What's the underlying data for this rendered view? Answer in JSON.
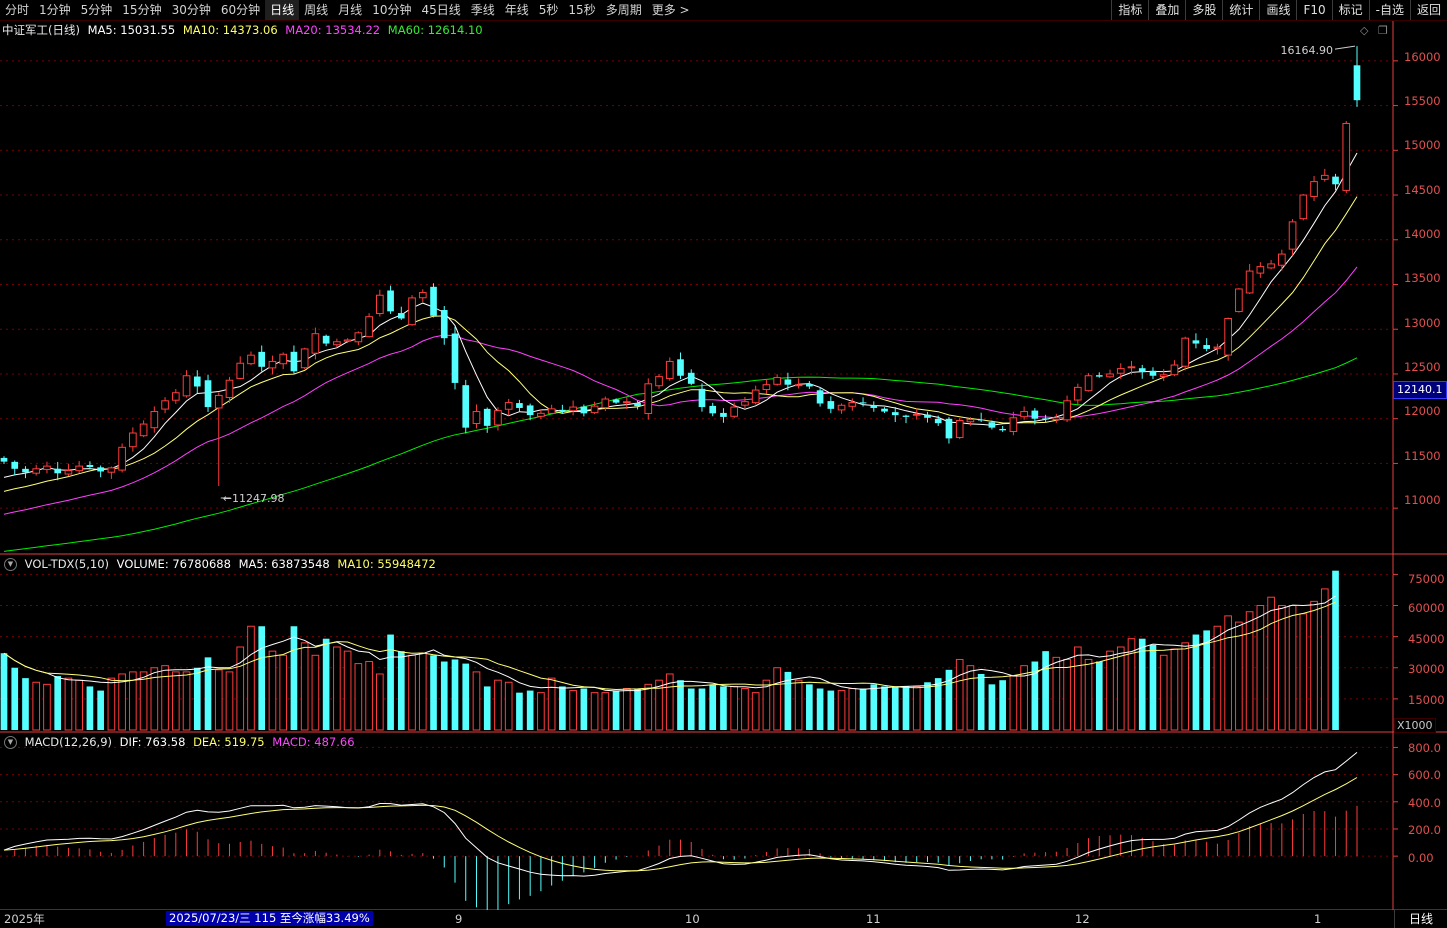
{
  "toolbar": {
    "periods": [
      "分时",
      "1分钟",
      "5分钟",
      "15分钟",
      "30分钟",
      "60分钟",
      "日线",
      "周线",
      "月线",
      "10分钟",
      "45日线",
      "季线",
      "年线",
      "5秒",
      "15秒",
      "多周期",
      "更多 >"
    ],
    "active_period": "日线",
    "tools": [
      "指标",
      "叠加",
      "多股",
      "统计",
      "画线",
      "F10",
      "标记",
      "-自选",
      "返回"
    ]
  },
  "price_header": {
    "name": "中证军工(日线)",
    "ma5": "MA5: 15031.55",
    "ma10": "MA10: 14373.06",
    "ma20": "MA20: 13534.22",
    "ma60": "MA60: 12614.10"
  },
  "volume_header": {
    "name": "VOL-TDX(5,10)",
    "volume": "VOLUME: 76780688",
    "ma5": "MA5: 63873548",
    "ma10": "MA10: 55948472"
  },
  "macd_header": {
    "name": "MACD(12,26,9)",
    "dif": "DIF: 763.58",
    "dea": "DEA: 519.75",
    "macd": "MACD: 487.66"
  },
  "annotations": {
    "high_label": "16164.90",
    "low_label": "11247.98",
    "current_price_tag": "12140.1",
    "volume_unit": "X1000"
  },
  "bottom": {
    "status_text": "2025/07/23/三 115 至今涨幅33.49%",
    "period_label": "日线",
    "x_labels": [
      "2025年",
      "9",
      "10",
      "11",
      "12",
      "1"
    ]
  },
  "colors": {
    "up": "#ff3c3c",
    "down": "#54ffff",
    "ma5": "#ffffff",
    "ma10": "#ffff77",
    "ma20": "#ff40ff",
    "ma60": "#00ee00",
    "axis": "#e04040",
    "grid": "#7a0000"
  },
  "chart_data": [
    {
      "type": "candlestick",
      "title": "中证军工(日线)",
      "y_axis_labels": [
        "16000",
        "15500",
        "15000",
        "14500",
        "14000",
        "13500",
        "13000",
        "12500",
        "12000",
        "11500",
        "11000"
      ],
      "ylim": [
        10700,
        16300
      ],
      "x_period_labels": [
        "2025年",
        "9",
        "10",
        "11",
        "12",
        "1"
      ],
      "high": 16164.9,
      "low": 11247.98,
      "last_close": 15560,
      "closes": [
        11520,
        11440,
        11400,
        11440,
        11470,
        11390,
        11420,
        11470,
        11460,
        11410,
        11450,
        11680,
        11840,
        11940,
        12080,
        12200,
        12290,
        12480,
        12360,
        12130,
        12260,
        12430,
        12620,
        12710,
        12580,
        12640,
        12720,
        12530,
        12780,
        12950,
        12840,
        12860,
        12880,
        12960,
        13140,
        13380,
        13200,
        13120,
        13350,
        13410,
        13150,
        12900,
        12400,
        11900,
        12080,
        11920,
        12090,
        12180,
        12120,
        12040,
        12060,
        12110,
        12090,
        12130,
        12060,
        12140,
        12220,
        12180,
        12190,
        12140,
        12390,
        12470,
        12640,
        12480,
        12390,
        12130,
        12060,
        12020,
        12130,
        12190,
        12320,
        12380,
        12460,
        12380,
        12380,
        12360,
        12170,
        12110,
        12150,
        12180,
        12180,
        12120,
        12080,
        12040,
        12020,
        12050,
        12010,
        11950,
        11780,
        11980,
        11990,
        11980,
        11900,
        11870,
        12010,
        12080,
        12000,
        12000,
        12010,
        12200,
        12350,
        12480,
        12470,
        12500,
        12560,
        12580,
        12520,
        12480,
        12490,
        12600,
        12900,
        12840,
        12780,
        12800,
        13120,
        13450,
        13650,
        13700,
        13730,
        13840,
        14200,
        14500,
        14650,
        14720,
        14620,
        15300,
        15560
      ],
      "ma_last": {
        "MA5": 15031.55,
        "MA10": 14373.06,
        "MA20": 13534.22,
        "MA60": 12614.1
      }
    },
    {
      "type": "bar",
      "title": "VOL-TDX(5,10)",
      "y_axis_labels": [
        "75000",
        "60000",
        "45000",
        "30000",
        "15000"
      ],
      "unit": "X1000",
      "ylim": [
        0,
        80000
      ],
      "volumes": [
        37000,
        30000,
        25000,
        23000,
        22000,
        26000,
        25000,
        24000,
        21000,
        19000,
        25000,
        27000,
        28000,
        28000,
        30000,
        31000,
        28000,
        28000,
        30000,
        35000,
        29000,
        28000,
        40000,
        50000,
        50000,
        38000,
        36000,
        50000,
        42000,
        36000,
        44000,
        40000,
        38000,
        32000,
        33000,
        27000,
        46000,
        38000,
        36000,
        37000,
        36000,
        33000,
        34000,
        32000,
        28000,
        21000,
        24000,
        23000,
        18000,
        19000,
        18000,
        25000,
        21000,
        19000,
        20000,
        18000,
        18000,
        19000,
        20000,
        20000,
        22000,
        24000,
        27000,
        24000,
        20000,
        20000,
        22000,
        21000,
        21000,
        20000,
        18000,
        24000,
        30000,
        28000,
        24000,
        22000,
        20000,
        19000,
        19000,
        20000,
        20000,
        22000,
        21000,
        21000,
        21000,
        21000,
        23000,
        25000,
        29000,
        34000,
        31000,
        27000,
        22000,
        24000,
        26000,
        31000,
        33000,
        38000,
        35000,
        34000,
        40000,
        34000,
        33000,
        38000,
        40000,
        44000,
        44000,
        41000,
        36000,
        39000,
        42000,
        46000,
        48000,
        50000,
        55000,
        52000,
        57000,
        60000,
        64000,
        60000,
        60000,
        56000,
        62000,
        68000,
        76780
      ]
    },
    {
      "type": "line",
      "title": "MACD(12,26,9)",
      "y_axis_labels": [
        "800.0",
        "600.0",
        "400.0",
        "200.0",
        "0.00"
      ],
      "ylim": [
        -330,
        840
      ],
      "series": [
        {
          "name": "DIF",
          "last": 763.58
        },
        {
          "name": "DEA",
          "last": 519.75
        },
        {
          "name": "MACD",
          "last": 487.66
        }
      ]
    }
  ]
}
